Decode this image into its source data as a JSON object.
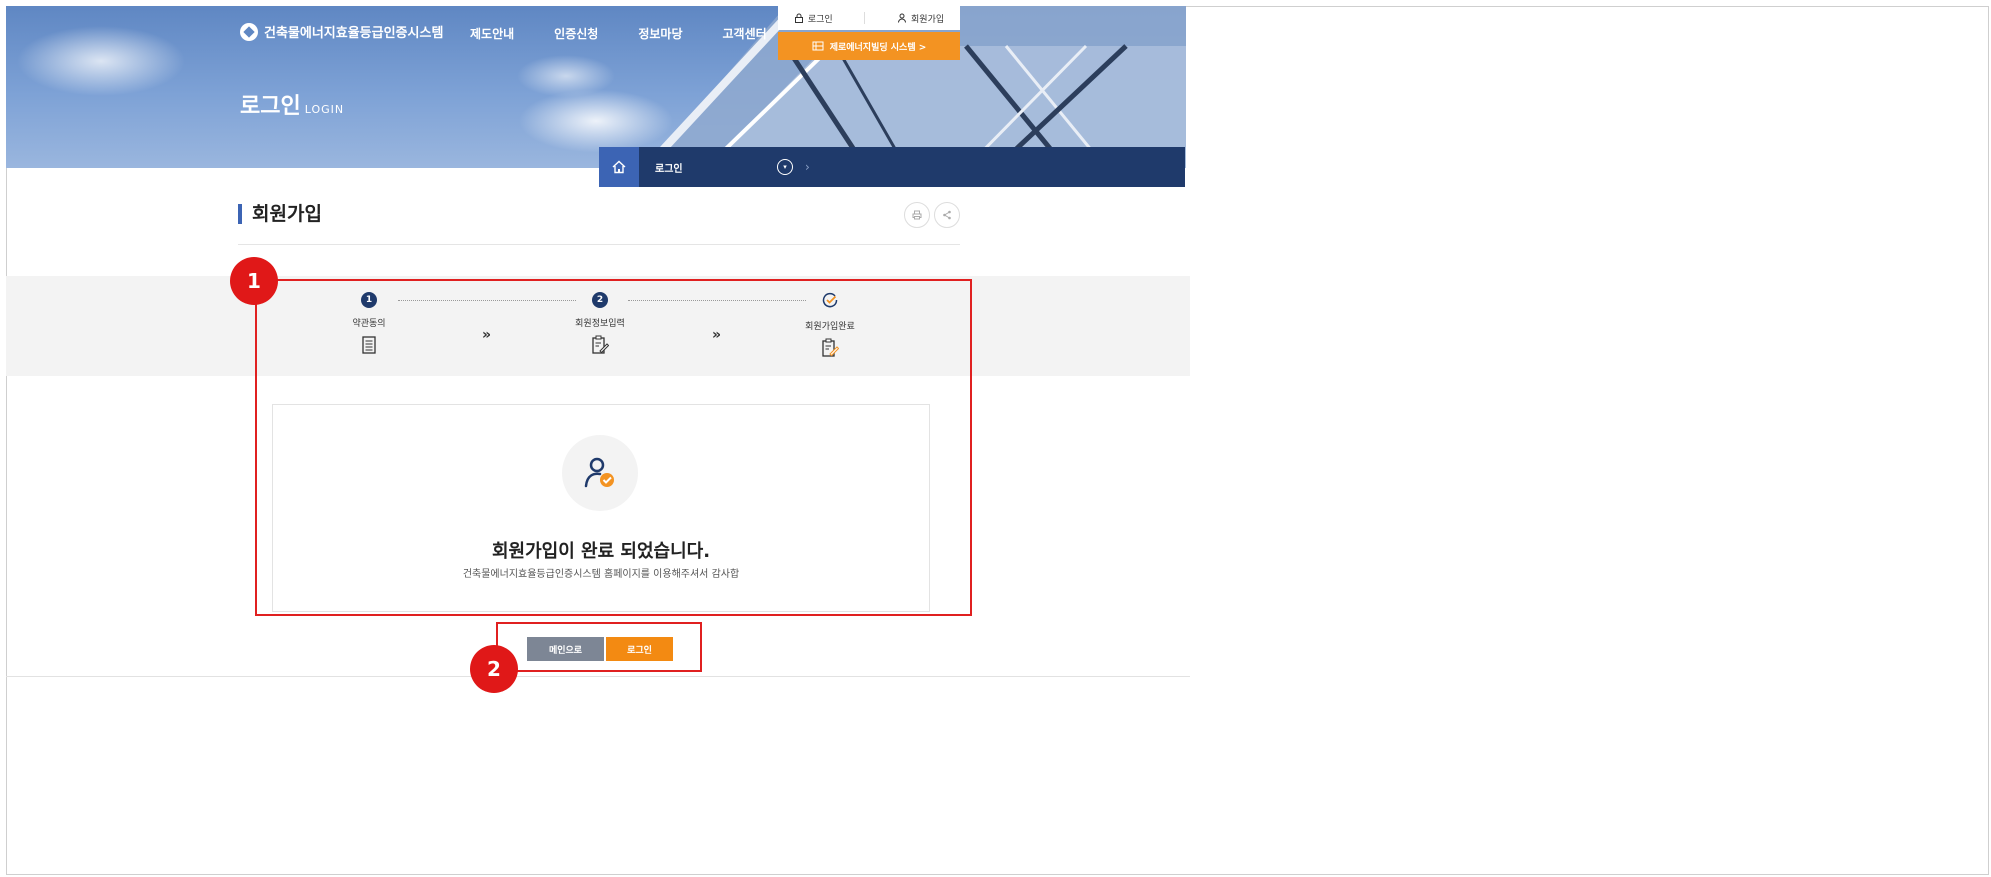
{
  "header": {
    "logo_text": "건축물에너지효율등급인증시스템",
    "nav": [
      "제도안내",
      "인증신청",
      "정보마당",
      "고객센터"
    ],
    "util_login": "로그인",
    "util_join": "회원가입",
    "zero_energy_button": "제로에너지빌딩 시스템  >"
  },
  "hero": {
    "title": "로그인",
    "subtitle": "LOGIN"
  },
  "location": {
    "current": "로그인"
  },
  "page": {
    "title": "회원가입"
  },
  "steps": [
    {
      "num": "1",
      "label": "약관동의"
    },
    {
      "num": "2",
      "label": "회원정보입력"
    },
    {
      "num": "",
      "label": "회원가입완료"
    }
  ],
  "step_chevron": "»",
  "result": {
    "title": "회원가입이 완료 되었습니다.",
    "message": "건축물에너지효율등급인증시스템 홈페이지를 이용해주셔서 감사합"
  },
  "actions": {
    "main_label": "메인으로",
    "login_label": "로그인"
  },
  "annotations": {
    "badge_1": "1",
    "badge_2": "2"
  },
  "colors": {
    "navy": "#1f3a6b",
    "accent_blue": "#3c64b4",
    "orange": "#f39322",
    "annotation_red": "#e02020"
  }
}
